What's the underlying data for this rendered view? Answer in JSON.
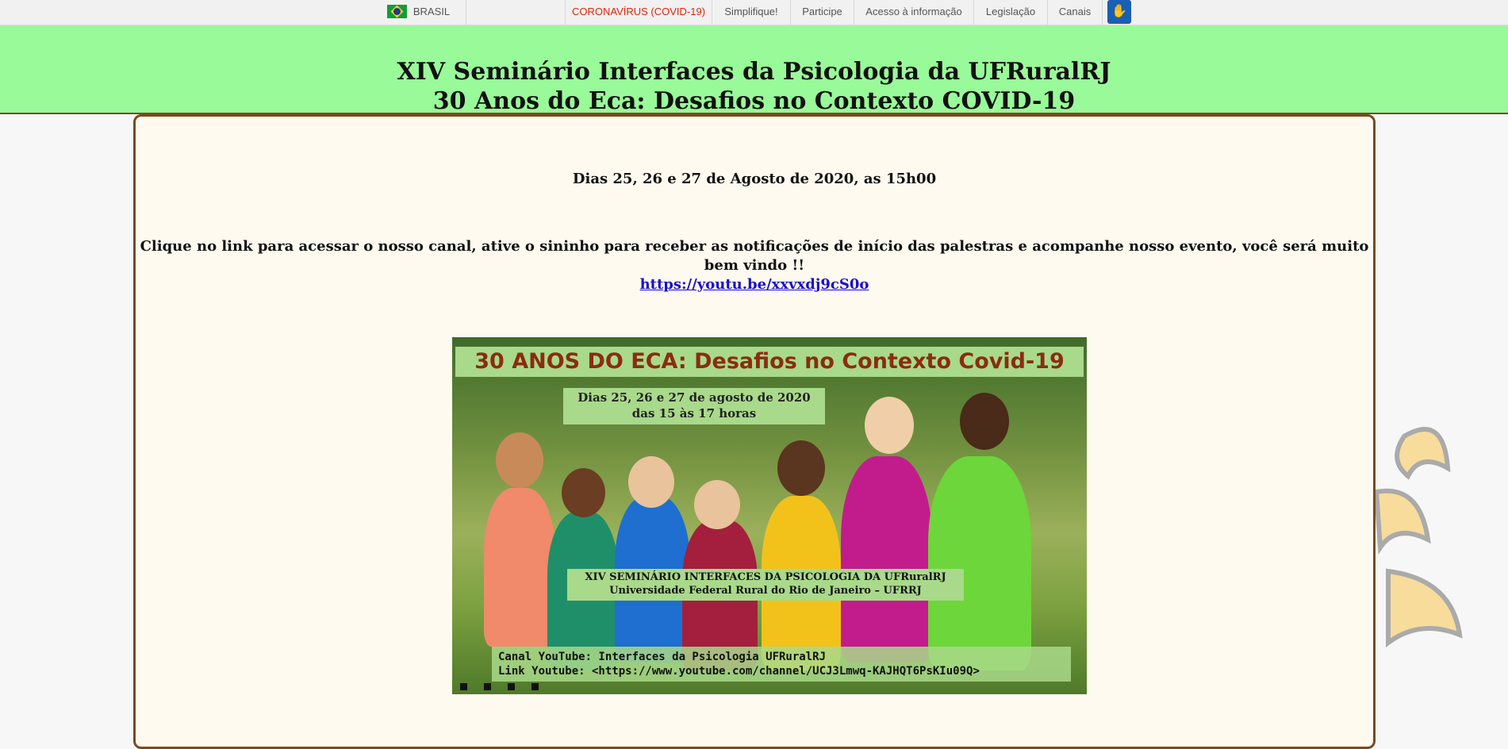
{
  "govbar": {
    "brasil": "BRASIL",
    "links": [
      "CORONAVÍRUS (COVID-19)",
      "Simplifique!",
      "Participe",
      "Acesso à informação",
      "Legislação",
      "Canais"
    ],
    "vlibras_icon": "hand-sign-icon"
  },
  "header": {
    "line1": "XIV Seminário Interfaces da Psicologia da UFRuralRJ",
    "line2": "30 Anos do Eca: Desafios no Contexto COVID-19"
  },
  "content": {
    "dates": "Dias 25, 26 e 27 de Agosto de 2020, as 15h00",
    "message": "Clique no link para acessar o nosso canal, ative o sininho para receber as notificações de início das palestras e acompanhe nosso evento, você será muito bem vindo !!",
    "link": "https://youtu.be/xxvxdj9cS0o"
  },
  "banner": {
    "title": "30 ANOS DO ECA: Desafios no Contexto Covid-19",
    "date_line1": "Dias 25, 26 e 27 de agosto de 2020",
    "date_line2": "das 15 às 17 horas",
    "seminar_line1": "XIV SEMINÁRIO INTERFACES DA PSICOLOGIA DA UFRuralRJ",
    "seminar_line2": "Universidade Federal Rural do Rio de Janeiro – UFRRJ",
    "channel_line1": "Canal YouTube: Interfaces da Psicologia UFRuralRJ",
    "channel_line2": "Link Youtube: <https://www.youtube.com/channel/UCJ3Lmwq-KAJHQT6PsKIu09Q>"
  },
  "colors": {
    "header_bg": "#99fa99",
    "panel_bg": "#fffaf0",
    "panel_border": "#7a4a22",
    "covid_link": "#e52207",
    "link": "#1a0dcc"
  }
}
